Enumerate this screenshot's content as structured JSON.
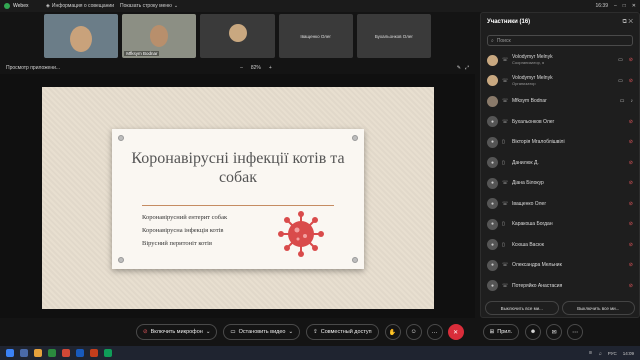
{
  "window": {
    "app_name": "Webex",
    "meeting_info": "Информация о совещании",
    "show_menu": "Показать строку меню",
    "time": "16:39"
  },
  "tiles": [
    {
      "name": ""
    },
    {
      "name": "Mfksym Bodnar"
    },
    {
      "name": ""
    },
    {
      "name": "Іващенко Олег"
    },
    {
      "name": "Бухальонков Олег"
    }
  ],
  "share_bar": {
    "label": "Просмотр приложени...",
    "zoom": "82%",
    "minus": "–",
    "plus": "+"
  },
  "slide": {
    "title": "Коронавірусні інфекції котів та собак",
    "items": [
      "Коронавірусний ентерит собак",
      "Коронавірусна інфекція котів",
      "Вірусний перитоніт котів"
    ]
  },
  "participants_panel": {
    "title": "Участники (16)",
    "search_placeholder": "Поиск",
    "list": [
      {
        "name": "Volodymyr Melnyk",
        "role": "Соорганизатор, я"
      },
      {
        "name": "Volodymyr Melnyk",
        "role": "Организатор"
      },
      {
        "name": "Mfksym Bodnar",
        "role": ""
      },
      {
        "name": "Бухальонков Олег",
        "role": ""
      },
      {
        "name": "Вікторія Мгалоблішвілі",
        "role": ""
      },
      {
        "name": "Данилюк Д.",
        "role": ""
      },
      {
        "name": "Діана Білокур",
        "role": ""
      },
      {
        "name": "Іващенко Олег",
        "role": ""
      },
      {
        "name": "Каракоша Богдан",
        "role": ""
      },
      {
        "name": "Ксюша Васюк",
        "role": ""
      },
      {
        "name": "Олександра Мельник",
        "role": ""
      },
      {
        "name": "Потеряйко Анастасия",
        "role": ""
      }
    ],
    "mute_all": "Выключить все ми...",
    "unmute_all": "Выключить все ми..."
  },
  "controls": {
    "mic": "Включить микрофон",
    "video": "Остановить видео",
    "share": "Совместный доступ",
    "apps": "Прил."
  },
  "taskbar": {
    "lang": "РУС",
    "clock": "14:09"
  },
  "colors": {
    "accent": "#d92d3a",
    "virus": "#d94b4b",
    "panel": "#1e1e1e"
  }
}
